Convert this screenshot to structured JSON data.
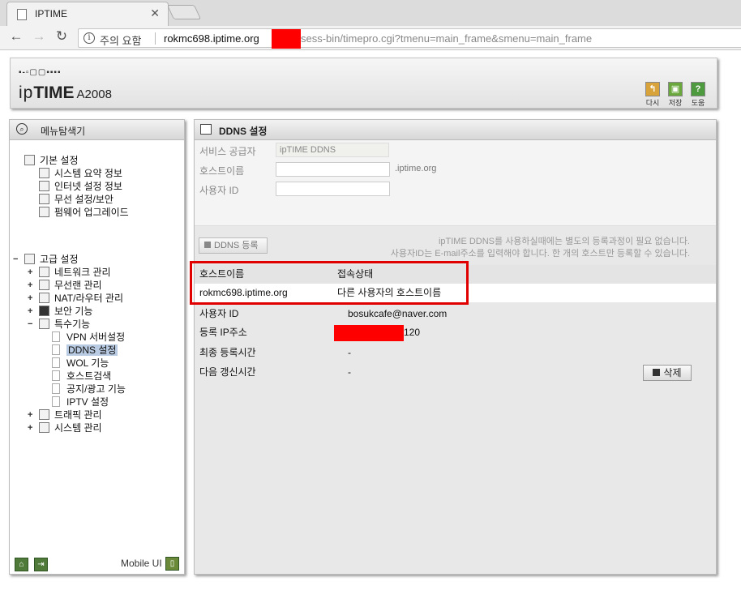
{
  "browser": {
    "tab_title": "IPTIME",
    "security_label": "주의 요함",
    "url_host": "rokmc698.iptime.org",
    "url_path": "sess-bin/timepro.cgi?tmenu=main_frame&smenu=main_frame"
  },
  "router": {
    "brand_prefix": "ip",
    "brand_bold": "TIME",
    "model": "A2008",
    "toolbar": [
      {
        "label": "다시",
        "icon": "undo-icon",
        "color": "#d9a33b"
      },
      {
        "label": "저장",
        "icon": "save-icon",
        "color": "#6aa83e"
      },
      {
        "label": "도움",
        "icon": "help-icon",
        "color": "#4e9a3e"
      }
    ]
  },
  "sidebar": {
    "title": "메뉴탐색기",
    "basic": {
      "label": "기본 설정",
      "items": [
        "시스템 요약 정보",
        "인터넷 설정 정보",
        "무선 설정/보안",
        "펌웨어 업그레이드"
      ]
    },
    "advanced": {
      "label": "고급 설정",
      "items": [
        "네트워크 관리",
        "무선랜 관리",
        "NAT/라우터 관리",
        "보안 기능",
        "특수기능"
      ],
      "special_items": [
        "VPN 서버설정",
        "DDNS 설정",
        "WOL 기능",
        "호스트검색",
        "공지/광고 기능",
        "IPTV 설정"
      ],
      "after_items": [
        "트래픽 관리",
        "시스템 관리"
      ]
    },
    "mobile_label": "Mobile UI"
  },
  "main": {
    "title": "DDNS 설정",
    "form": {
      "provider_label": "서비스 공급자",
      "provider_value": "ipTIME DDNS",
      "hostname_label": "호스트이름",
      "hostname_suffix": ".iptime.org",
      "userid_label": "사용자 ID"
    },
    "register_button": "DDNS 등록",
    "note_line1": "ipTIME DDNS를 사용하실때에는 별도의 등록과정이 필요 없습니다.",
    "note_line2": "사용자ID는 E-mail주소를 입력해야 합니다. 한 개의 호스트만 등록할 수 있습니다.",
    "table": {
      "headers": [
        "호스트이름",
        "접속상태"
      ],
      "row": [
        "rokmc698.iptime.org",
        "다른 사용자의 호스트이름"
      ]
    },
    "details": [
      {
        "label": "사용자 ID",
        "value": "bosukcafe@naver.com"
      },
      {
        "label": "등록 IP주소",
        "value": "120"
      },
      {
        "label": "최종 등록시간",
        "value": "-"
      },
      {
        "label": "다음 갱신시간",
        "value": "-"
      }
    ],
    "delete_button": "삭제"
  }
}
